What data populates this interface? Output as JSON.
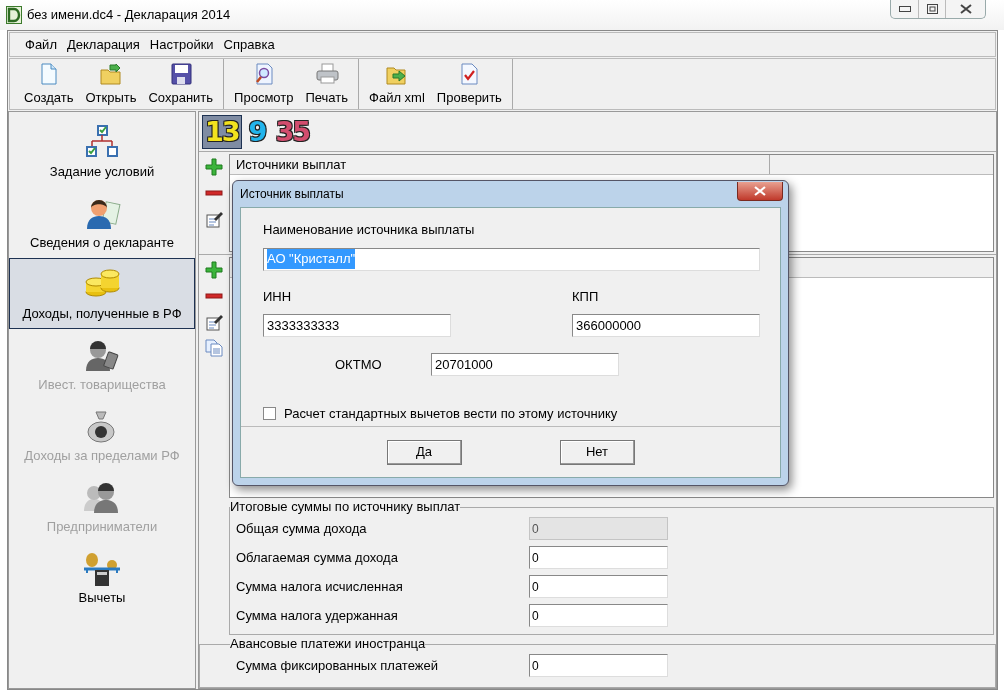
{
  "window": {
    "title": "без имени.dc4 - Декларация 2014"
  },
  "menu": [
    "Файл",
    "Декларация",
    "Настройки",
    "Справка"
  ],
  "toolbar_groups": [
    {
      "buttons": [
        {
          "label": "Создать",
          "kind": "new"
        },
        {
          "label": "Открыть",
          "kind": "open"
        },
        {
          "label": "Сохранить",
          "kind": "save"
        }
      ]
    },
    {
      "buttons": [
        {
          "label": "Просмотр",
          "kind": "preview"
        },
        {
          "label": "Печать",
          "kind": "print"
        }
      ]
    },
    {
      "buttons": [
        {
          "label": "Файл xml",
          "kind": "xml"
        },
        {
          "label": "Проверить",
          "kind": "check"
        }
      ]
    }
  ],
  "sidebar": {
    "items": [
      {
        "label": "Задание условий",
        "kind": "conditions",
        "selected": false,
        "disabled": false
      },
      {
        "label": "Сведения о декларанте",
        "kind": "person",
        "selected": false,
        "disabled": false
      },
      {
        "label": "Доходы, полученные в РФ",
        "kind": "coins",
        "selected": true,
        "disabled": false
      },
      {
        "label": "Ивест. товарищества",
        "kind": "investor",
        "selected": false,
        "disabled": true
      },
      {
        "label": "Доходы за пределами РФ",
        "kind": "moneybag",
        "selected": false,
        "disabled": true
      },
      {
        "label": "Предприниматели",
        "kind": "business",
        "selected": false,
        "disabled": true
      },
      {
        "label": "Вычеты",
        "kind": "deductions",
        "selected": false,
        "disabled": false
      }
    ]
  },
  "rates": [
    {
      "label": "13",
      "selected": true,
      "color": "#f2e21e"
    },
    {
      "label": "9",
      "selected": false,
      "color": "#22b4ec"
    },
    {
      "label": "35",
      "selected": false,
      "color": "#d24d6e"
    }
  ],
  "sources_panel": {
    "tools": [
      {
        "kind": "add"
      },
      {
        "kind": "remove"
      },
      {
        "kind": "edit"
      }
    ],
    "columns": [
      "Источники выплат"
    ]
  },
  "income_panel": {
    "tools": [
      {
        "kind": "add"
      },
      {
        "kind": "remove"
      },
      {
        "kind": "edit"
      },
      {
        "kind": "copy"
      }
    ]
  },
  "totals": {
    "legend": "Итоговые суммы по источнику выплат",
    "rows": [
      {
        "label": "Общая сумма дохода",
        "value": "0",
        "disabled": true
      },
      {
        "label": "Облагаемая сумма дохода",
        "value": "0",
        "disabled": false
      },
      {
        "label": "Сумма налога исчисленная",
        "value": "0",
        "disabled": false
      },
      {
        "label": "Сумма налога удержанная",
        "value": "0",
        "disabled": false
      }
    ]
  },
  "advance": {
    "legend": "Авансовые платежи иностранца",
    "rows": [
      {
        "label": "Сумма фиксированных платежей",
        "value": "0",
        "disabled": false
      }
    ]
  },
  "dialog": {
    "title": "Источник выплаты",
    "name_label": "Наименование источника выплаты",
    "name_value": "АО \"Кристалл\"",
    "name_selected": true,
    "inn_label": "ИНН",
    "inn_value": "3333333333",
    "kpp_label": "КПП",
    "kpp_value": "366000000",
    "oktmo_label": "ОКТМО",
    "oktmo_value": "20701000",
    "checkbox": {
      "label": "Расчет стандартных вычетов вести по этому источнику",
      "checked": false
    },
    "buttons": [
      "Да",
      "Нет"
    ]
  }
}
